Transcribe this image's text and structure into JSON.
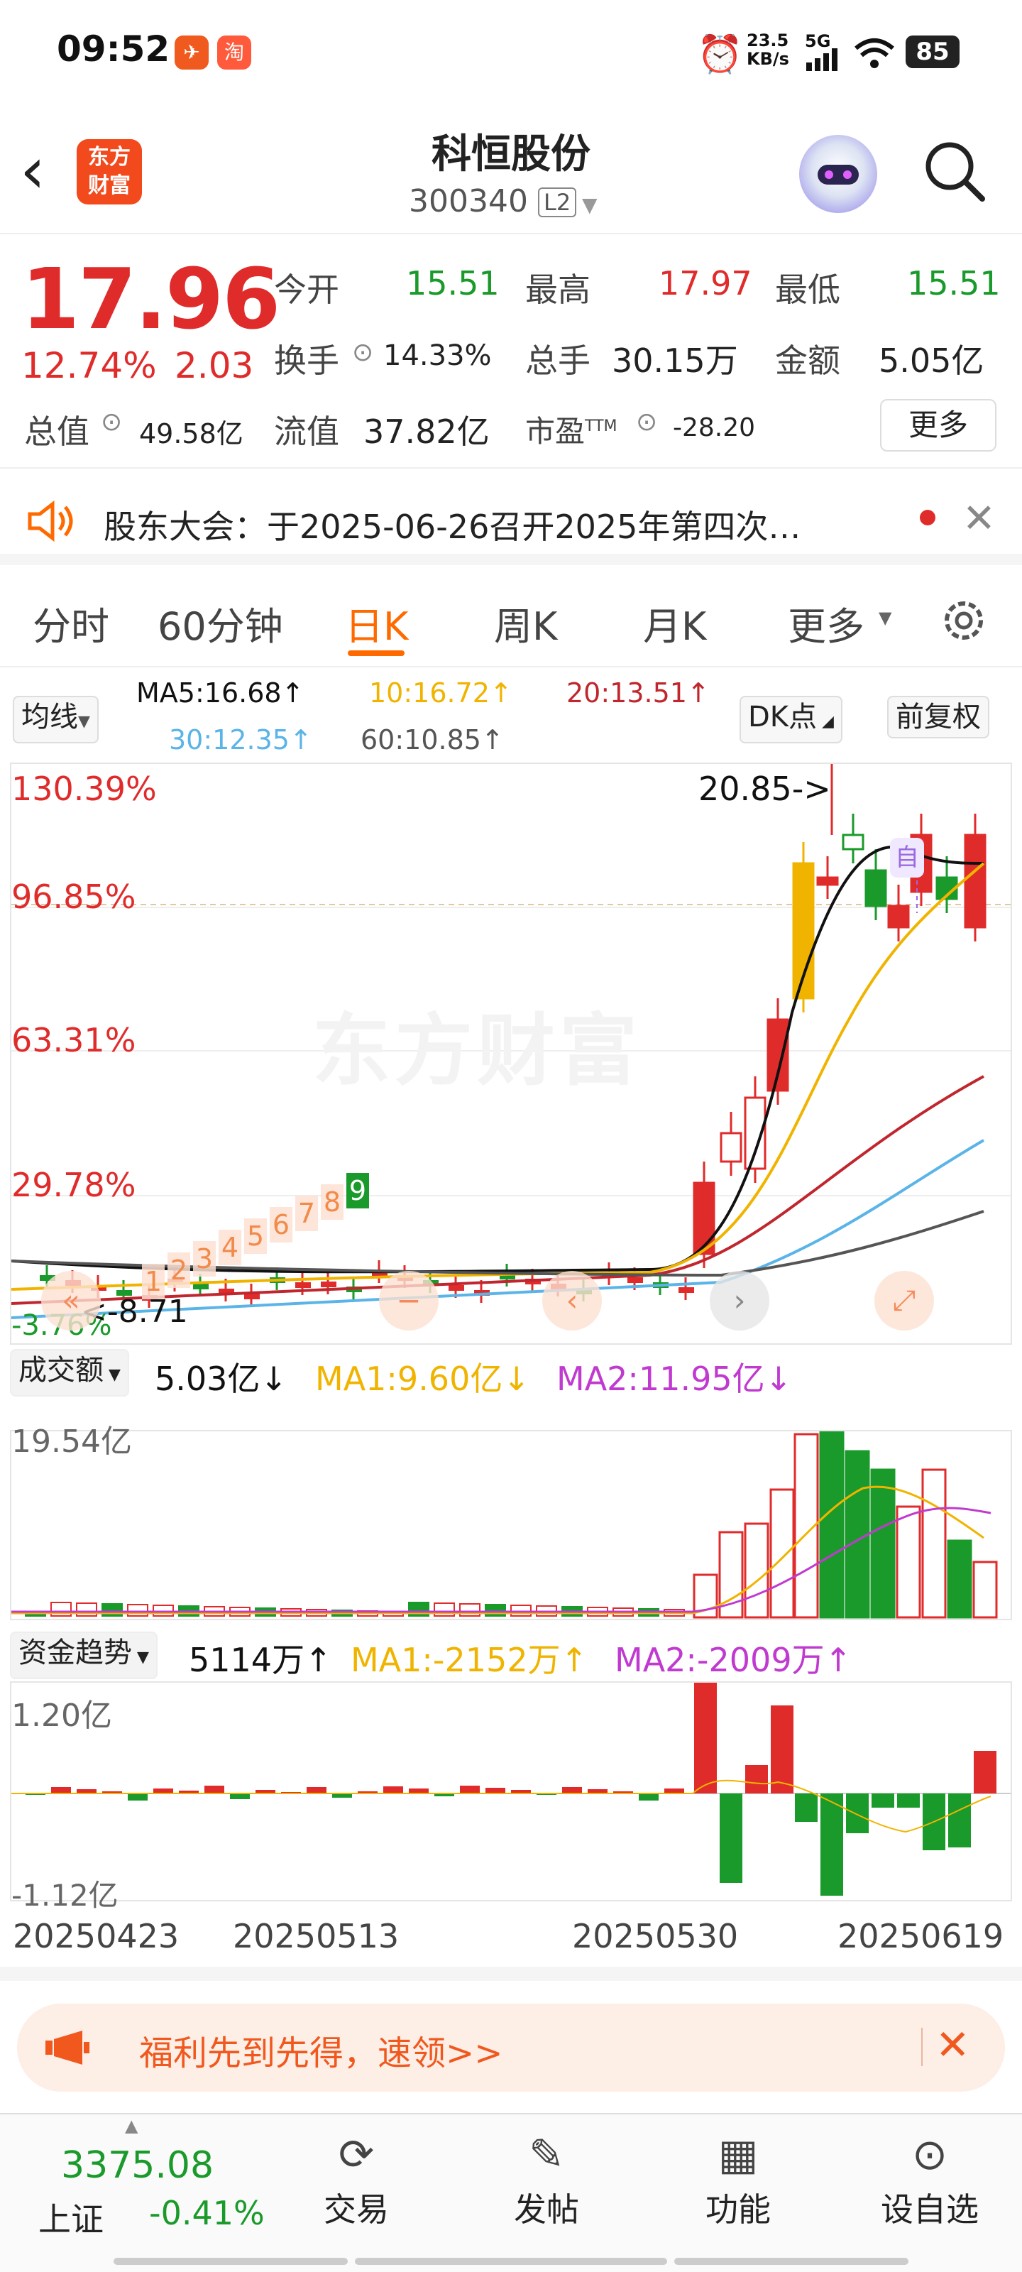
{
  "status_bar": {
    "time": "09:52",
    "net_speed": "23.5\nKB/s",
    "signal": "5G",
    "battery": "85"
  },
  "header": {
    "title": "科恒股份",
    "code": "300340",
    "level": "L2",
    "logo_text": "东方\n财富"
  },
  "quote": {
    "price": "17.96",
    "change_pct": "12.74%",
    "change": "2.03",
    "stats": [
      {
        "label": "今开",
        "value": "15.51",
        "color": "green"
      },
      {
        "label": "最高",
        "value": "17.97",
        "color": "red"
      },
      {
        "label": "最低",
        "value": "15.51",
        "color": "green"
      },
      {
        "label": "换手",
        "value": "14.33%",
        "color": "black"
      },
      {
        "label": "总手",
        "value": "30.15万",
        "color": "black"
      },
      {
        "label": "金额",
        "value": "5.05亿",
        "color": "black"
      },
      {
        "label": "总值",
        "value": "49.58亿",
        "color": "black"
      },
      {
        "label": "流值",
        "value": "37.82亿",
        "color": "black"
      },
      {
        "label": "市盈TTM",
        "value": "-28.20",
        "color": "black"
      }
    ],
    "more_label": "更多"
  },
  "notice": {
    "text": "股东大会：于2025-06-26召开2025年第四次…"
  },
  "tabs": [
    "分时",
    "60分钟",
    "日K",
    "周K",
    "月K",
    "更多"
  ],
  "active_tab": "日K",
  "ma_bar": {
    "selector": "均线",
    "ma5": "MA5:16.68↑",
    "ma10": "10:16.72↑",
    "ma20": "20:13.51↑",
    "ma30": "30:12.35↑",
    "ma60": "60:10.85↑",
    "dk_label": "DK点",
    "adjust_label": "前复权"
  },
  "kline": {
    "y_labels": [
      "130.39%",
      "96.85%",
      "63.31%",
      "29.78%",
      "-3.76%"
    ],
    "max_marker": "20.85->",
    "min_marker": "<-8.71",
    "self_tag": "自",
    "watermark": "东方财富",
    "seq_numbers": [
      "1",
      "2",
      "3",
      "4",
      "5",
      "6",
      "7",
      "8",
      "9"
    ]
  },
  "volume": {
    "selector": "成交额",
    "value": "5.03亿↓",
    "ma1": "MA1:9.60亿↓",
    "ma2": "MA2:11.95亿↓",
    "top_label": "19.54亿"
  },
  "flow": {
    "selector": "资金趋势",
    "value": "5114万↑",
    "ma1": "MA1:-2152万↑",
    "ma2": "MA2:-2009万↑",
    "top_label": "1.20亿",
    "bottom_label": "-1.12亿"
  },
  "dates": [
    "20250423",
    "20250513",
    "20250530",
    "20250619"
  ],
  "banner": {
    "text": "福利先到先得，速领>>"
  },
  "bottom_nav": {
    "index_value": "3375.08",
    "index_name": "上证",
    "index_change": "-0.41%",
    "items": [
      "交易",
      "发帖",
      "功能",
      "设自选"
    ]
  },
  "colors": {
    "up": "#e02b2b",
    "down": "#1a9a2a",
    "accent": "#ff6a00",
    "ma5": "#111111",
    "ma10": "#f0b400",
    "ma20": "#c0262e",
    "ma30": "#5ab4e8",
    "ma60": "#555555",
    "vol_ma2": "#c03ad0"
  }
}
